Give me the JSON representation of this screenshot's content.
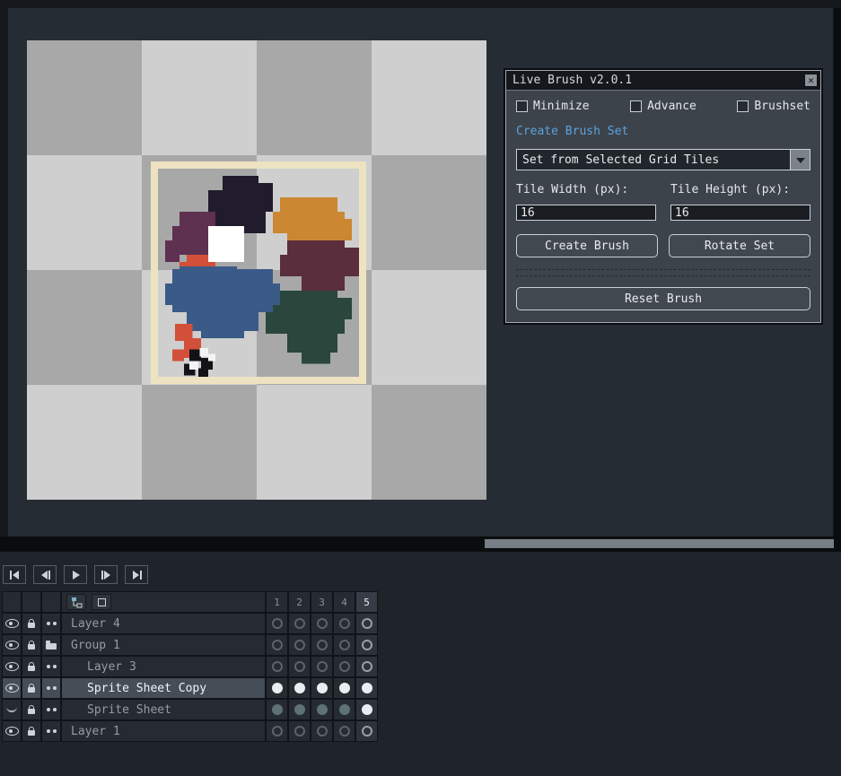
{
  "canvas": {
    "checker_dark": "#a8a8a8",
    "checker_light": "#cfcfcf",
    "sprite_frame_color": "#eee3c1",
    "sprite_blobs": [
      {
        "name": "dark-navy-blob",
        "color": "#211c2c",
        "rects": [
          [
            4.5,
            0.5,
            2.5,
            1
          ],
          [
            3.5,
            1.5,
            4,
            1.5
          ],
          [
            4,
            3,
            3.5,
            1.5
          ],
          [
            6.5,
            1,
            1.5,
            2
          ]
        ]
      },
      {
        "name": "orange-blob",
        "color": "#cc8733",
        "rects": [
          [
            8.5,
            2,
            4,
            1
          ],
          [
            8,
            3,
            5,
            1.5
          ],
          [
            9,
            4.5,
            3.5,
            1
          ],
          [
            12,
            3.5,
            1.5,
            1.5
          ]
        ]
      },
      {
        "name": "plum-blob",
        "color": "#5e3150",
        "rects": [
          [
            1.5,
            3,
            2.5,
            1
          ],
          [
            1,
            4,
            3,
            2
          ],
          [
            0.5,
            5,
            1,
            1.5
          ],
          [
            2,
            6,
            2,
            1.5
          ]
        ]
      },
      {
        "name": "maroon-blob",
        "color": "#5a2e3c",
        "rects": [
          [
            9,
            5,
            4,
            1
          ],
          [
            8.5,
            6,
            5,
            1.5
          ],
          [
            10,
            7.5,
            3,
            1
          ],
          [
            12.5,
            5.5,
            1.5,
            2
          ]
        ]
      },
      {
        "name": "red-orange-blob",
        "color": "#d25039",
        "rects": [
          [
            2,
            6,
            2,
            1
          ],
          [
            1.5,
            6.5,
            2.5,
            1.5
          ]
        ]
      },
      {
        "name": "blue-blob",
        "color": "#3a5a88",
        "rects": [
          [
            1.5,
            6.8,
            4,
            0.6
          ],
          [
            1,
            7,
            7,
            3
          ],
          [
            0.5,
            8,
            0.8,
            1.5
          ],
          [
            2,
            10,
            5,
            1.3
          ],
          [
            7.5,
            8,
            1,
            2
          ],
          [
            3,
            11,
            3,
            0.8
          ]
        ]
      },
      {
        "name": "teal-blob",
        "color": "#2b463d",
        "rects": [
          [
            8.5,
            8.5,
            4,
            1
          ],
          [
            8,
            9.5,
            5,
            2
          ],
          [
            9,
            11.5,
            3.5,
            1.3
          ],
          [
            7.5,
            10,
            1,
            1.5
          ],
          [
            12.5,
            9,
            1,
            1.5
          ],
          [
            10,
            12.8,
            2,
            0.8
          ]
        ]
      },
      {
        "name": "bottom-orange-bits",
        "color": "#d25039",
        "rects": [
          [
            1.2,
            10.8,
            1.2,
            1.2
          ],
          [
            1.8,
            11.8,
            1.2,
            1.4
          ],
          [
            1,
            12.6,
            0.8,
            0.8
          ]
        ]
      },
      {
        "name": "white-brush-cursor",
        "color": "#ffffff",
        "rects": [
          [
            3.5,
            4,
            2.5,
            2.5
          ]
        ]
      },
      {
        "name": "black-pixel-bits",
        "color": "#121217",
        "rects": [
          [
            2.2,
            12.6,
            0.8,
            0.8
          ],
          [
            3,
            13.2,
            0.8,
            0.8
          ],
          [
            1.8,
            13.6,
            0.8,
            0.8
          ],
          [
            2.8,
            13.9,
            0.7,
            0.6
          ]
        ]
      },
      {
        "name": "white-pixel-bits",
        "color": "#f4f4f4",
        "rects": [
          [
            2.9,
            12.5,
            0.6,
            0.6
          ],
          [
            2.2,
            13.4,
            0.6,
            0.6
          ],
          [
            3.5,
            12.9,
            0.5,
            0.5
          ]
        ]
      }
    ]
  },
  "dialog": {
    "title": "Live Brush v2.0.1",
    "close_glyph": "×",
    "checkboxes": [
      {
        "label": "Minimize",
        "checked": false
      },
      {
        "label": "Advance",
        "checked": false
      },
      {
        "label": "Brushset",
        "checked": false
      }
    ],
    "section_link": "Create Brush Set",
    "dropdown_value": "Set from Selected Grid Tiles",
    "tile_width_label": "Tile Width (px):",
    "tile_height_label": "Tile Height (px):",
    "tile_width_value": "16",
    "tile_height_value": "16",
    "create_button": "Create Brush",
    "rotate_button": "Rotate Set",
    "reset_button": "Reset Brush",
    "accent_color": "#5ca2dc"
  },
  "timeline": {
    "playback": [
      {
        "name": "go-to-first-frame",
        "icon": "skip-start"
      },
      {
        "name": "previous-frame",
        "icon": "step-back"
      },
      {
        "name": "play",
        "icon": "play"
      },
      {
        "name": "next-frame",
        "icon": "step-forward"
      },
      {
        "name": "go-to-last-frame",
        "icon": "skip-end"
      }
    ],
    "frame_numbers": [
      "1",
      "2",
      "3",
      "4",
      "5"
    ],
    "current_frame_index": 4,
    "rows": [
      {
        "name": "Layer 4",
        "indent": 0,
        "type": "layer",
        "eye": "open",
        "selected": false,
        "cells": [
          "empty",
          "empty",
          "empty",
          "empty",
          "empty"
        ]
      },
      {
        "name": "Group 1",
        "indent": 0,
        "type": "group",
        "eye": "open",
        "selected": false,
        "cells": [
          "empty",
          "empty",
          "empty",
          "empty",
          "empty"
        ]
      },
      {
        "name": "Layer 3",
        "indent": 1,
        "type": "layer",
        "eye": "open",
        "selected": false,
        "cells": [
          "empty",
          "empty",
          "empty",
          "empty",
          "empty"
        ]
      },
      {
        "name": "Sprite Sheet Copy",
        "indent": 1,
        "type": "layer",
        "eye": "open",
        "selected": true,
        "cells": [
          "filled",
          "filled",
          "filled",
          "filled",
          "filled"
        ]
      },
      {
        "name": "Sprite Sheet",
        "indent": 1,
        "type": "layer",
        "eye": "closed",
        "selected": false,
        "cells": [
          "dim",
          "dim",
          "dim",
          "dim",
          "filled"
        ]
      },
      {
        "name": "Layer 1",
        "indent": 0,
        "type": "layer",
        "eye": "open",
        "selected": false,
        "cells": [
          "empty",
          "empty",
          "empty",
          "empty",
          "empty"
        ]
      }
    ]
  }
}
